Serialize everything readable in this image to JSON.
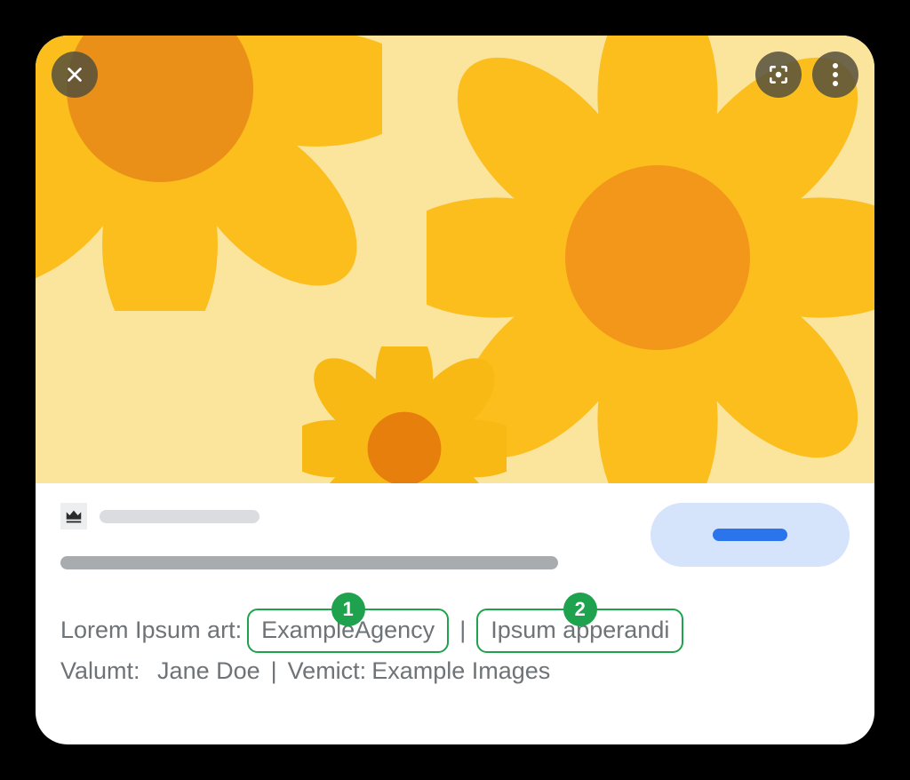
{
  "callouts": {
    "one": "1",
    "two": "2"
  },
  "meta": {
    "line1_prefix": "Lorem Ipsum art:",
    "line1_chip1": "ExampleAgency",
    "line1_sep": "|",
    "line1_chip2": "Ipsum apperandi",
    "line2_label1": "Valumt:",
    "line2_value1": "Jane Doe",
    "line2_sep": "|",
    "line2_label2": "Vemict:",
    "line2_value2": "Example Images"
  }
}
